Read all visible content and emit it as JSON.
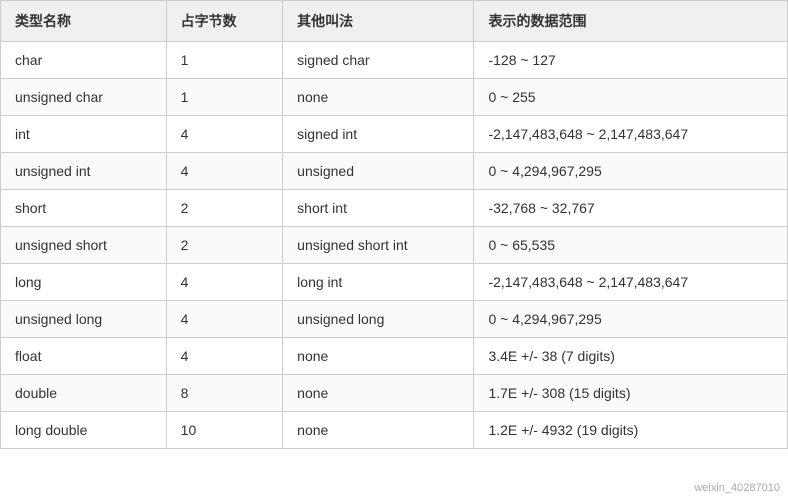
{
  "table": {
    "headers": [
      "类型名称",
      "占字节数",
      "其他叫法",
      "表示的数据范围"
    ],
    "rows": [
      [
        "char",
        "1",
        "signed char",
        "-128 ~ 127"
      ],
      [
        "unsigned char",
        "1",
        "none",
        "0 ~ 255"
      ],
      [
        "int",
        "4",
        "signed int",
        "-2,147,483,648 ~ 2,147,483,647"
      ],
      [
        "unsigned int",
        "4",
        "unsigned",
        "0 ~ 4,294,967,295"
      ],
      [
        "short",
        "2",
        "short int",
        "-32,768 ~ 32,767"
      ],
      [
        "unsigned short",
        "2",
        "unsigned short int",
        "0 ~ 65,535"
      ],
      [
        "long",
        "4",
        "long int",
        "-2,147,483,648 ~ 2,147,483,647"
      ],
      [
        "unsigned long",
        "4",
        "unsigned long",
        "0 ~ 4,294,967,295"
      ],
      [
        "float",
        "4",
        "none",
        "3.4E +/- 38 (7 digits)"
      ],
      [
        "double",
        "8",
        "none",
        "1.7E +/- 308 (15 digits)"
      ],
      [
        "long double",
        "10",
        "none",
        "1.2E +/- 4932 (19 digits)"
      ]
    ],
    "watermark": "weixin_40287010"
  }
}
